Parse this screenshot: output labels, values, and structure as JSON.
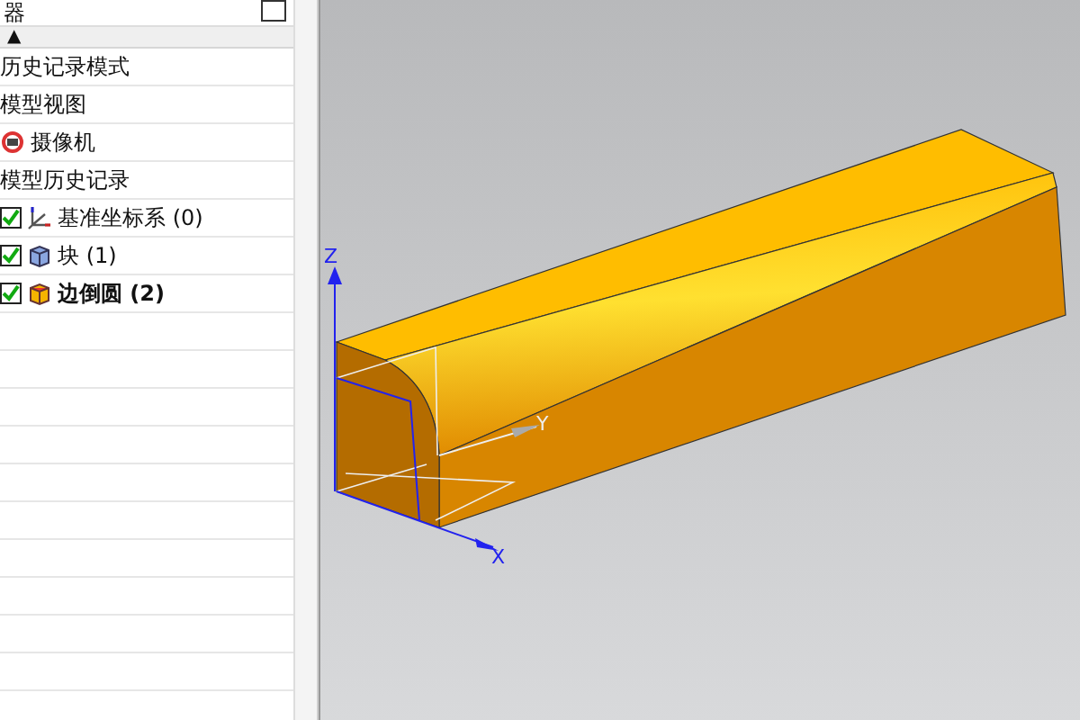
{
  "navigator": {
    "title": "器",
    "pin_checked": false,
    "column_header": {
      "sort_indicator": "▲"
    },
    "tree": [
      {
        "label": "历史记录模式"
      },
      {
        "label": "模型视图",
        "children": [
          {
            "label": "摄像机",
            "kind": "camera"
          }
        ]
      },
      {
        "label": "模型历史记录",
        "children": [
          {
            "label": "基准坐标系 (0)",
            "kind": "datum",
            "checked": true,
            "current": false
          },
          {
            "label": "块 (1)",
            "kind": "block",
            "checked": true,
            "current": false
          },
          {
            "label": "边倒圆 (2)",
            "kind": "blend",
            "checked": true,
            "current": true
          }
        ]
      }
    ]
  },
  "viewport": {
    "axes": {
      "z": "Z",
      "y": "Y",
      "x": "X"
    }
  }
}
